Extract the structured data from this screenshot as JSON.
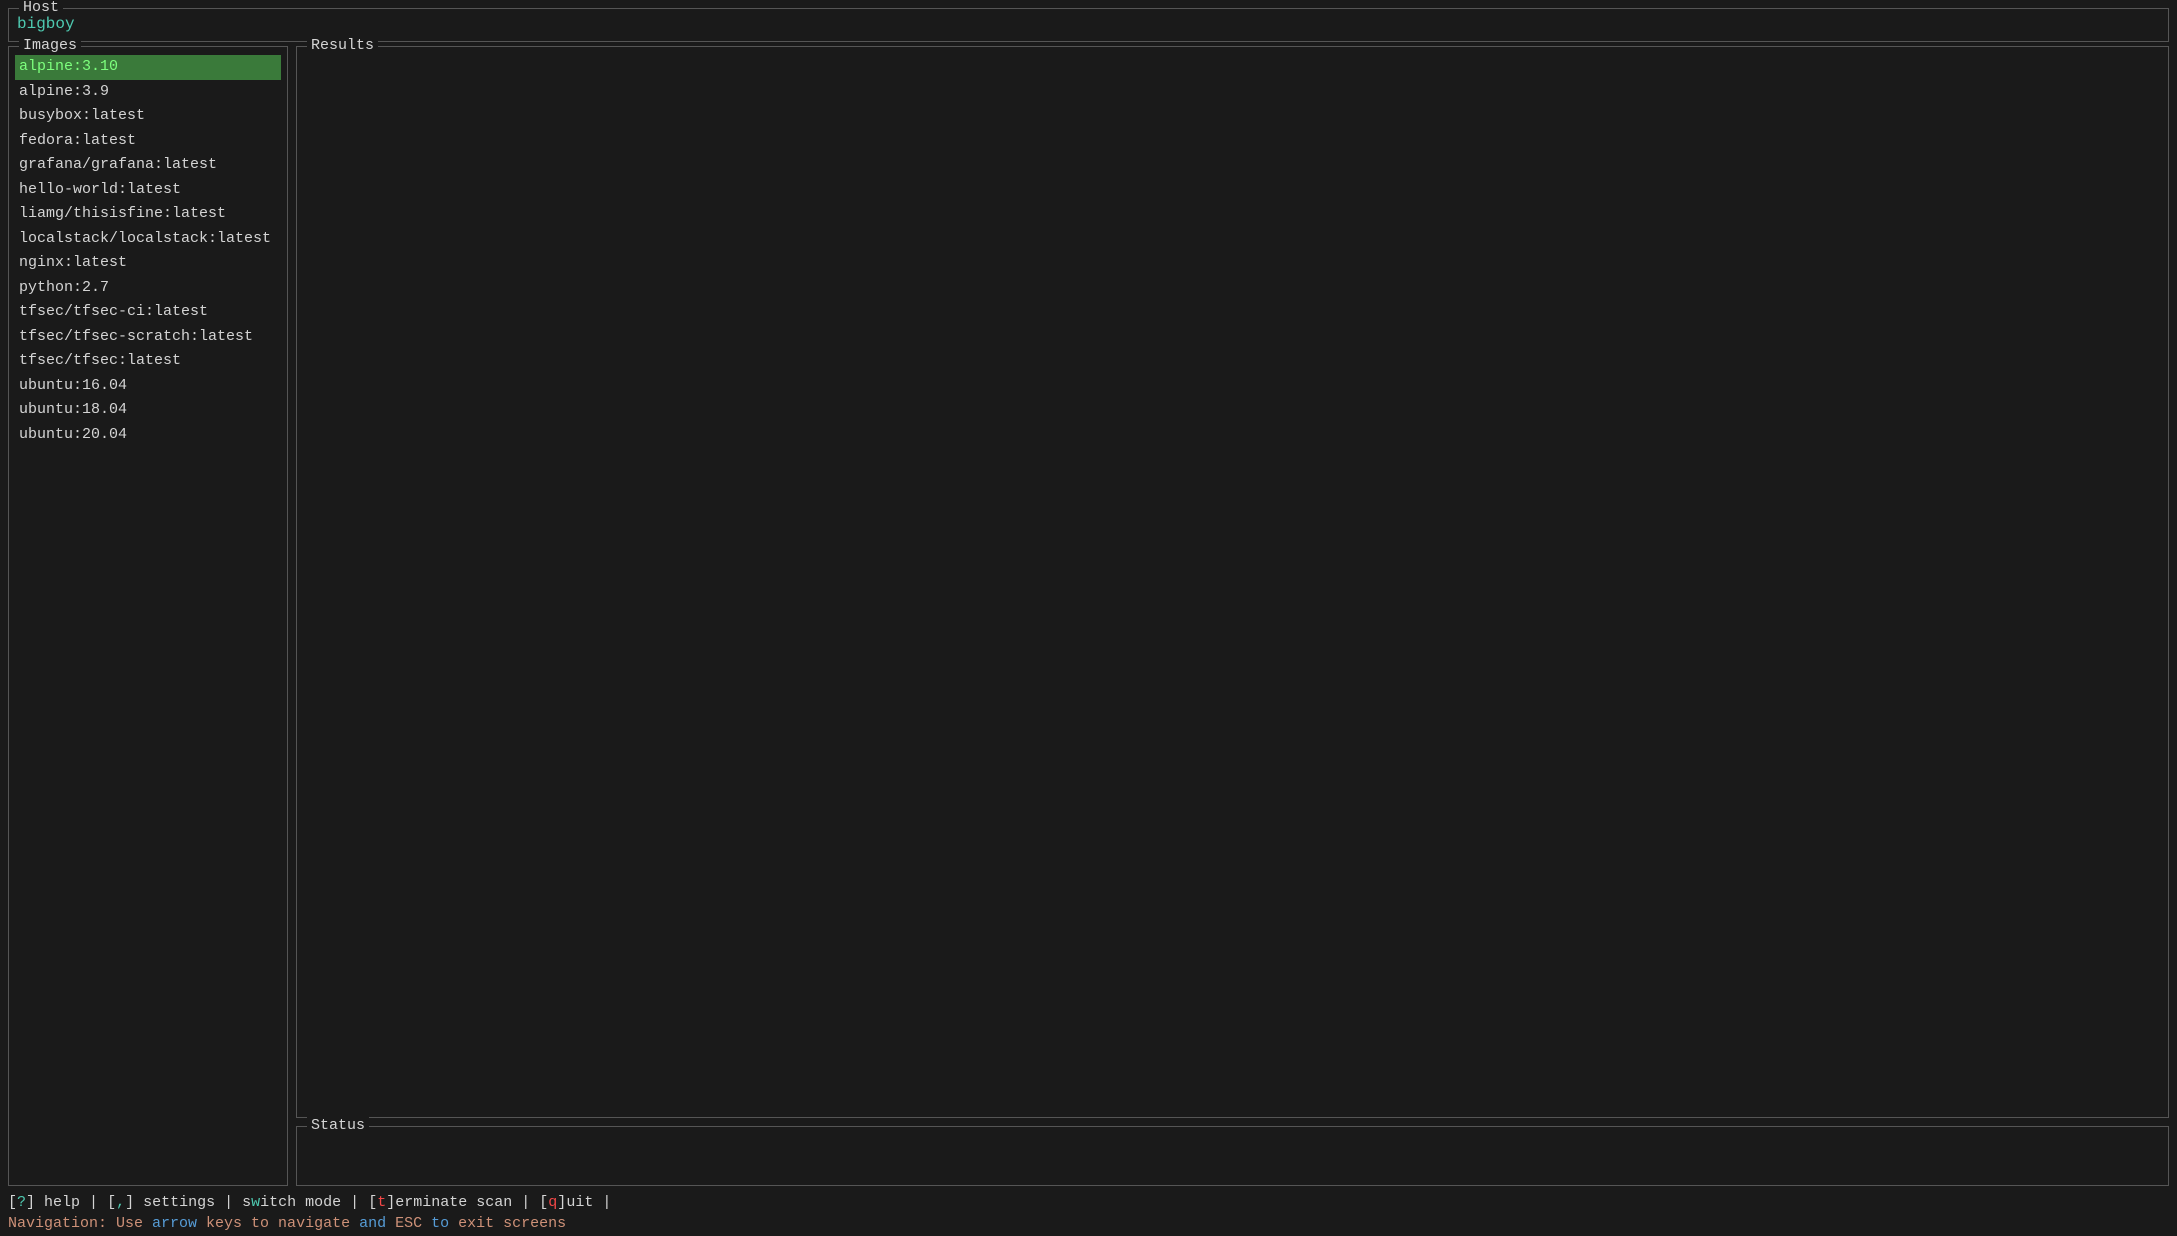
{
  "host": {
    "label": "Host",
    "name": "bigboy"
  },
  "images": {
    "label": "Images",
    "items": [
      {
        "name": "alpine:3.10",
        "selected": true
      },
      {
        "name": "alpine:3.9",
        "selected": false
      },
      {
        "name": "busybox:latest",
        "selected": false
      },
      {
        "name": "fedora:latest",
        "selected": false
      },
      {
        "name": "grafana/grafana:latest",
        "selected": false
      },
      {
        "name": "hello-world:latest",
        "selected": false
      },
      {
        "name": "liamg/thisisfine:latest",
        "selected": false
      },
      {
        "name": "localstack/localstack:latest",
        "selected": false
      },
      {
        "name": "nginx:latest",
        "selected": false
      },
      {
        "name": "python:2.7",
        "selected": false
      },
      {
        "name": "tfsec/tfsec-ci:latest",
        "selected": false
      },
      {
        "name": "tfsec/tfsec-scratch:latest",
        "selected": false
      },
      {
        "name": "tfsec/tfsec:latest",
        "selected": false
      },
      {
        "name": "ubuntu:16.04",
        "selected": false
      },
      {
        "name": "ubuntu:18.04",
        "selected": false
      },
      {
        "name": "ubuntu:20.04",
        "selected": false
      }
    ]
  },
  "results": {
    "label": "Results",
    "content": ""
  },
  "status": {
    "label": "Status",
    "content": ""
  },
  "shortcuts": {
    "help_bracket_open": "[",
    "help_key": "?",
    "help_bracket_close": "]",
    "help_label": " help  |  ",
    "settings_bracket_open": "[",
    "settings_key": ",",
    "settings_bracket_close": "]",
    "settings_label": " settings  |  s",
    "switch_key": "w",
    "switch_label": "itch mode  |  ",
    "terminate_bracket_open": "[",
    "terminate_key": "t",
    "terminate_bracket_close": "]",
    "terminate_label": "erminate scan  |  ",
    "quit_bracket_open": "[",
    "quit_key": "q",
    "quit_bracket_close": "]",
    "quit_label": "uit  |"
  },
  "navigation": {
    "prefix": "Navigation: Use ",
    "arrow": "arrow",
    "middle1": " keys to navigate ",
    "and": "and",
    "middle2": " ESC ",
    "to": "to",
    "suffix": " exit screens"
  }
}
